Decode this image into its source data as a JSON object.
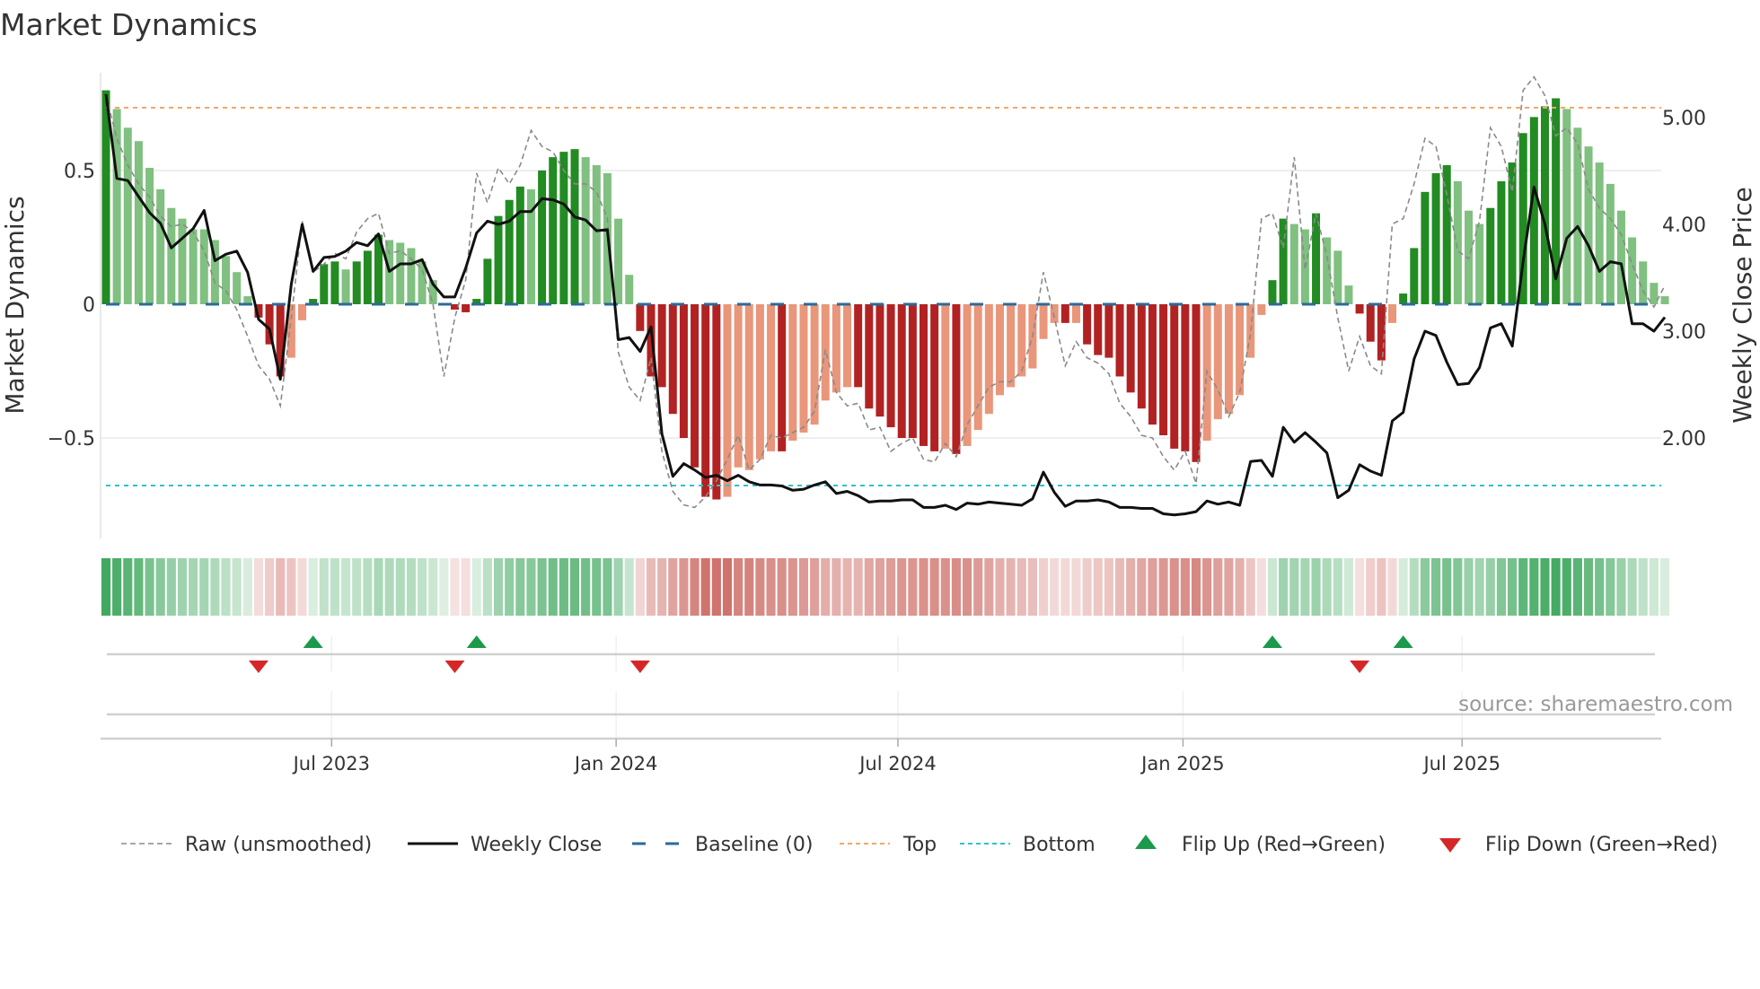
{
  "title": "Market Dynamics",
  "source": "source: sharemaestro.com",
  "chart_data": {
    "type": "bar",
    "title": "Market Dynamics",
    "ylabel": "Market Dynamics",
    "y2label": "Weekly Close Price",
    "ylim": [
      -0.876,
      0.866
    ],
    "y2lim": [
      1.06,
      5.42
    ],
    "yticks": [
      {
        "value": 0.5,
        "label": "0.5"
      },
      {
        "value": 0,
        "label": "0"
      },
      {
        "value": -0.5,
        "label": "−0.5"
      }
    ],
    "y2ticks": [
      {
        "value": 5,
        "label": "5.00"
      },
      {
        "value": 4,
        "label": "4.00"
      },
      {
        "value": 3,
        "label": "3.00"
      },
      {
        "value": 2,
        "label": "2.00"
      }
    ],
    "xticks": [
      {
        "week": 21.7,
        "label": "Jul 2023"
      },
      {
        "week": 47.8,
        "label": "Jan 2024"
      },
      {
        "week": 73.65,
        "label": "Jul 2024"
      },
      {
        "week": 99.8,
        "label": "Jan 2025"
      },
      {
        "week": 125.4,
        "label": "Jul 2025"
      }
    ],
    "top_level": 0.735,
    "bottom_level": -0.678,
    "baseline": 0,
    "momentum": [
      0.8,
      0.73,
      0.66,
      0.61,
      0.51,
      0.43,
      0.36,
      0.32,
      0.28,
      0.28,
      0.24,
      0.18,
      0.12,
      0.03,
      -0.05,
      -0.15,
      -0.27,
      -0.2,
      -0.06,
      0.02,
      0.15,
      0.16,
      0.13,
      0.16,
      0.2,
      0.26,
      0.24,
      0.23,
      0.21,
      0.16,
      0.09,
      0.005,
      -0.02,
      -0.03,
      0.02,
      0.17,
      0.33,
      0.39,
      0.44,
      0.43,
      0.5,
      0.55,
      0.57,
      0.58,
      0.55,
      0.52,
      0.49,
      0.32,
      0.11,
      -0.1,
      -0.27,
      -0.31,
      -0.41,
      -0.5,
      -0.61,
      -0.72,
      -0.73,
      -0.72,
      -0.61,
      -0.62,
      -0.58,
      -0.55,
      -0.55,
      -0.51,
      -0.48,
      -0.45,
      -0.36,
      -0.33,
      -0.31,
      -0.31,
      -0.39,
      -0.42,
      -0.46,
      -0.5,
      -0.5,
      -0.53,
      -0.55,
      -0.54,
      -0.56,
      -0.53,
      -0.47,
      -0.41,
      -0.34,
      -0.31,
      -0.27,
      -0.24,
      -0.13,
      -0.07,
      -0.07,
      -0.07,
      -0.15,
      -0.19,
      -0.2,
      -0.27,
      -0.33,
      -0.39,
      -0.45,
      -0.49,
      -0.54,
      -0.55,
      -0.59,
      -0.51,
      -0.43,
      -0.41,
      -0.34,
      -0.2,
      -0.04,
      0.09,
      0.32,
      0.3,
      0.28,
      0.34,
      0.25,
      0.2,
      0.07,
      -0.035,
      -0.14,
      -0.21,
      -0.07,
      0.04,
      0.21,
      0.42,
      0.49,
      0.52,
      0.46,
      0.35,
      0.3,
      0.36,
      0.46,
      0.53,
      0.64,
      0.7,
      0.74,
      0.77,
      0.73,
      0.66,
      0.59,
      0.53,
      0.45,
      0.35,
      0.25,
      0.16,
      0.08,
      0.03
    ],
    "strength": "SWWWWWWWWWWWWWSSSWWSSSWSSSWWWWWWSSSSSSSWSSSSWWWWWSSSSSSSSWWWWWSWWWWWWSSSSSSSSWSWWWWWWWWWSWSSSSSSSSSSSWWWWWWSSWWSWWWSSSWSSSSSWWWSSSSSSSWWWWWWWWWW",
    "raw": [
      0.78,
      0.62,
      0.52,
      0.45,
      0.4,
      0.33,
      0.29,
      0.3,
      0.27,
      0.2,
      0.08,
      0.05,
      -0.02,
      -0.12,
      -0.23,
      -0.28,
      -0.38,
      -0.05,
      0.31,
      0.12,
      0.15,
      0.19,
      0.17,
      0.27,
      0.32,
      0.34,
      0.19,
      0.2,
      0.17,
      0.13,
      0.0,
      -0.27,
      -0.05,
      0.09,
      0.49,
      0.38,
      0.51,
      0.45,
      0.52,
      0.65,
      0.59,
      0.57,
      0.5,
      0.45,
      0.45,
      0.42,
      0.32,
      -0.18,
      -0.31,
      -0.36,
      -0.2,
      -0.55,
      -0.7,
      -0.75,
      -0.76,
      -0.72,
      -0.66,
      -0.58,
      -0.49,
      -0.62,
      -0.58,
      -0.49,
      -0.5,
      -0.48,
      -0.46,
      -0.4,
      -0.17,
      -0.33,
      -0.38,
      -0.37,
      -0.47,
      -0.46,
      -0.55,
      -0.52,
      -0.5,
      -0.58,
      -0.59,
      -0.52,
      -0.57,
      -0.45,
      -0.38,
      -0.31,
      -0.29,
      -0.29,
      -0.25,
      -0.12,
      0.12,
      -0.05,
      -0.23,
      -0.14,
      -0.2,
      -0.22,
      -0.26,
      -0.37,
      -0.42,
      -0.49,
      -0.5,
      -0.57,
      -0.62,
      -0.55,
      -0.67,
      -0.25,
      -0.32,
      -0.42,
      -0.33,
      -0.11,
      0.32,
      0.34,
      0.21,
      0.55,
      0.13,
      0.34,
      0.18,
      -0.05,
      -0.25,
      -0.12,
      -0.23,
      -0.26,
      0.3,
      0.32,
      0.45,
      0.62,
      0.59,
      0.41,
      0.2,
      0.17,
      0.31,
      0.66,
      0.59,
      0.42,
      0.8,
      0.85,
      0.78,
      0.63,
      0.66,
      0.6,
      0.43,
      0.36,
      0.32,
      0.26,
      0.15,
      0.05,
      -0.01,
      0.07
    ],
    "close": [
      5.22,
      4.43,
      4.41,
      4.26,
      4.11,
      4.01,
      3.78,
      3.87,
      3.96,
      4.13,
      3.66,
      3.72,
      3.75,
      3.55,
      3.11,
      3.02,
      2.55,
      3.44,
      4.0,
      3.56,
      3.69,
      3.7,
      3.75,
      3.83,
      3.8,
      3.91,
      3.56,
      3.63,
      3.63,
      3.67,
      3.44,
      3.32,
      3.32,
      3.59,
      3.92,
      4.03,
      4.0,
      4.03,
      4.12,
      4.12,
      4.24,
      4.23,
      4.19,
      4.07,
      4.04,
      3.94,
      3.95,
      2.92,
      2.94,
      2.81,
      3.04,
      2.04,
      1.64,
      1.76,
      1.7,
      1.63,
      1.65,
      1.6,
      1.65,
      1.59,
      1.56,
      1.56,
      1.55,
      1.51,
      1.52,
      1.56,
      1.59,
      1.48,
      1.5,
      1.46,
      1.4,
      1.41,
      1.41,
      1.42,
      1.42,
      1.35,
      1.35,
      1.37,
      1.33,
      1.39,
      1.38,
      1.4,
      1.39,
      1.38,
      1.37,
      1.43,
      1.68,
      1.49,
      1.36,
      1.41,
      1.41,
      1.42,
      1.4,
      1.35,
      1.35,
      1.34,
      1.34,
      1.29,
      1.28,
      1.29,
      1.31,
      1.41,
      1.38,
      1.4,
      1.37,
      1.78,
      1.79,
      1.64,
      2.1,
      1.96,
      2.05,
      1.96,
      1.86,
      1.44,
      1.51,
      1.75,
      1.69,
      1.65,
      2.16,
      2.24,
      2.74,
      3.0,
      2.96,
      2.71,
      2.5,
      2.51,
      2.66,
      3.03,
      3.07,
      2.86,
      3.65,
      4.35,
      4.0,
      3.49,
      3.87,
      3.98,
      3.8,
      3.56,
      3.65,
      3.63,
      3.07,
      3.07,
      3.0,
      3.13
    ],
    "flip_up_weeks": [
      20,
      35,
      108,
      120
    ],
    "flip_down_weeks": [
      15,
      33,
      50,
      116
    ],
    "legend": [
      {
        "key": "raw",
        "label": "Raw (unsmoothed)"
      },
      {
        "key": "close",
        "label": "Weekly Close"
      },
      {
        "key": "baseline",
        "label": "Baseline (0)"
      },
      {
        "key": "top",
        "label": "Top"
      },
      {
        "key": "bottom",
        "label": "Bottom"
      },
      {
        "key": "flip_up",
        "label": "Flip Up (Red→Green)"
      },
      {
        "key": "flip_down",
        "label": "Flip Down (Green→Red)"
      }
    ],
    "legend_position": "bottom",
    "colors": {
      "strong_up": "#228b22",
      "weak_up": "#80c080",
      "strong_down": "#b22222",
      "weak_down": "#e9967a",
      "raw": "#8a8a8a",
      "close": "#111111",
      "baseline": "#2b6a9a",
      "top": "#f0a868",
      "bottom": "#2cc3cf",
      "flip_up": "#1a9a4a",
      "flip_down": "#d62728"
    }
  }
}
